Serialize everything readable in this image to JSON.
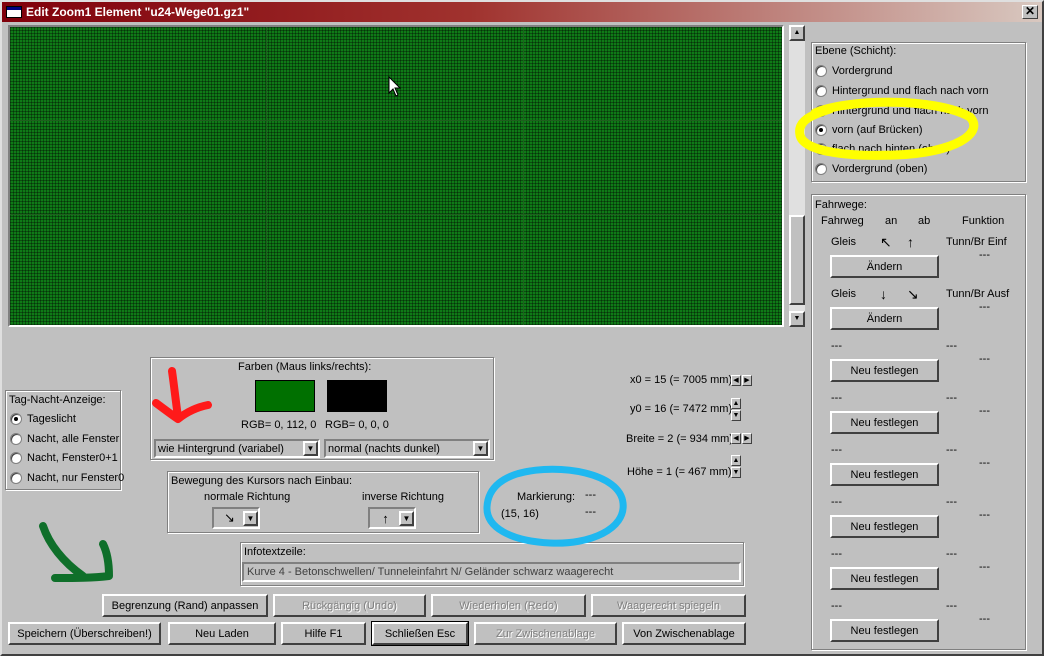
{
  "window": {
    "title": "Edit Zoom1 Element \"u24-Wege01.gz1\"",
    "close": "✕"
  },
  "cursor_icon": "arrow-pointer",
  "ebene": {
    "legend": "Ebene (Schicht):",
    "options": [
      "Vordergrund",
      "Hintergrund und flach nach vorn",
      "Hintergrund und flach nach vorn",
      "vorn (auf Brücken)",
      "flach nach hinten (oben)",
      "Vordergrund (oben)"
    ],
    "selected": 3
  },
  "fahrwege": {
    "legend": "Fahrwege:",
    "headers": {
      "fahrweg": "Fahrweg",
      "an": "an",
      "ab": "ab",
      "funktion": "Funktion"
    },
    "rows": [
      {
        "fahrweg": "Gleis",
        "an": "↖",
        "ab": "↑",
        "funktion": "Tunn/Br Einf",
        "dash": "---",
        "button": "Ändern"
      },
      {
        "fahrweg": "Gleis",
        "an": "↓",
        "ab": "↘",
        "funktion": "Tunn/Br Ausf",
        "dash": "---",
        "button": "Ändern"
      },
      {
        "fahrweg": "---",
        "an": "",
        "ab": "",
        "funktion": "---",
        "dash": "---",
        "button": "Neu festlegen"
      },
      {
        "fahrweg": "---",
        "an": "",
        "ab": "",
        "funktion": "---",
        "dash": "---",
        "button": "Neu festlegen"
      },
      {
        "fahrweg": "---",
        "an": "",
        "ab": "",
        "funktion": "---",
        "dash": "---",
        "button": "Neu festlegen"
      },
      {
        "fahrweg": "---",
        "an": "",
        "ab": "",
        "funktion": "---",
        "dash": "---",
        "button": "Neu festlegen"
      },
      {
        "fahrweg": "---",
        "an": "",
        "ab": "",
        "funktion": "---",
        "dash": "---",
        "button": "Neu festlegen"
      },
      {
        "fahrweg": "---",
        "an": "",
        "ab": "",
        "funktion": "---",
        "dash": "---",
        "button": "Neu festlegen"
      }
    ]
  },
  "tag_nacht": {
    "legend": "Tag-Nacht-Anzeige:",
    "options": [
      "Tageslicht",
      "Nacht, alle Fenster",
      "Nacht, Fenster0+1",
      "Nacht, nur Fenster0"
    ],
    "selected": 0
  },
  "farben": {
    "legend": "Farben (Maus links/rechts):",
    "left": {
      "color": "#007000",
      "rgb": "RGB= 0, 112, 0",
      "combo": "wie Hintergrund (variabel)"
    },
    "right": {
      "color": "#000000",
      "rgb": "RGB= 0, 0, 0",
      "combo": "normal (nachts dunkel)"
    }
  },
  "bewegung": {
    "legend": "Bewegung des Kursors nach Einbau:",
    "normal_label": "normale Richtung",
    "normal_value": "↘",
    "inverse_label": "inverse Richtung",
    "inverse_value": "↑"
  },
  "markierung": {
    "label": "Markierung:",
    "dash1": "---",
    "coords": "(15, 16)",
    "dash2": "---"
  },
  "coords": {
    "x0": "x0 = 15 (= 7005 mm)",
    "y0": "y0 = 16 (= 7472 mm)",
    "breite": "Breite = 2 (= 934 mm)",
    "hoehe": "Höhe = 1 (= 467 mm)"
  },
  "info": {
    "legend": "Infotextzeile:",
    "text": "Kurve 4 - Betonschwellen/ Tunneleinfahrt N/ Geländer schwarz waagerecht"
  },
  "buttons": {
    "begrenzung": "Begrenzung (Rand) anpassen",
    "undo": "Rückgängig (Undo)",
    "redo": "Wiederholen (Redo)",
    "spiegeln": "Waagerecht spiegeln",
    "speichern": "Speichern (Überschreiben!)",
    "neu_laden": "Neu Laden",
    "hilfe": "Hilfe     F1",
    "schliessen": "Schließen  Esc",
    "zur_zw": "Zur Zwischenablage",
    "von_zw": "Von Zwischenablage"
  },
  "annotation_colors": {
    "yellow": "#ffff00",
    "red": "#ff1a1a",
    "blue": "#1fb8f0",
    "green": "#0f6f2a"
  }
}
